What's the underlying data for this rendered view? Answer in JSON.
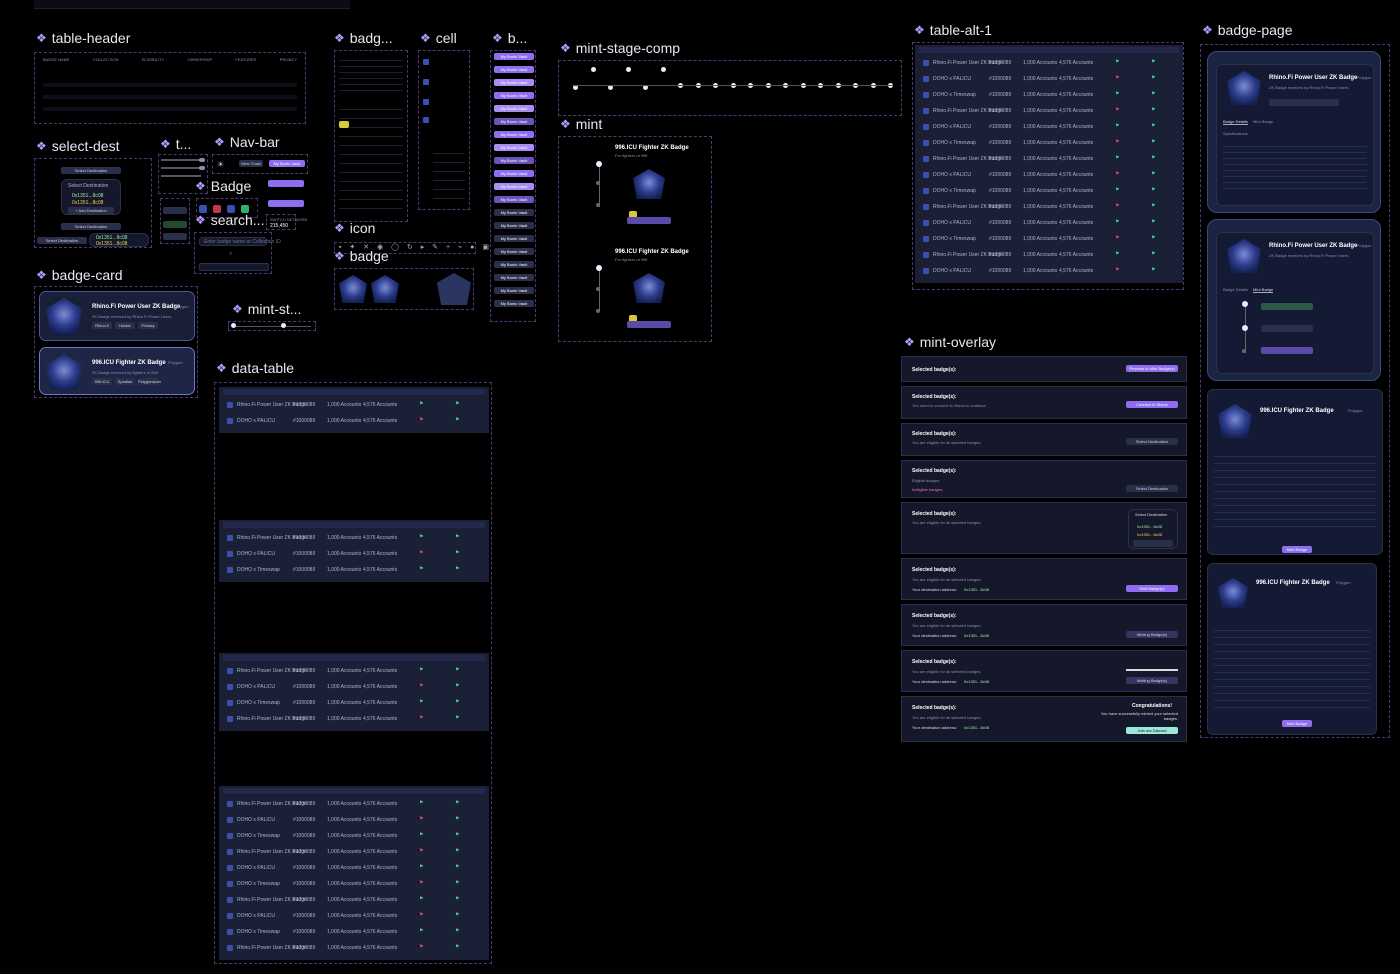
{
  "sections": {
    "table_header": "table-header",
    "select_dest": "select-dest",
    "t": "t...",
    "nav_bar": "Nav-bar",
    "badge_small": "Badge",
    "search": "search...",
    "badge_card": "badge-card",
    "badg": "badg...",
    "cell": "cell",
    "icon": "icon",
    "badge": "badge",
    "b": "b...",
    "mint_stage_comp": "mint-stage-comp",
    "mint": "mint",
    "mint_st": "mint-st...",
    "data_table": "data-table",
    "table_alt_1": "table-alt-1",
    "mint_overlay": "mint-overlay",
    "badge_page": "badge-page"
  },
  "select_dest": {
    "label": "Select Destination",
    "option1": "0x1351...8c08",
    "option2": "0x1351...8c08",
    "add": "+ Add Destination"
  },
  "nav_bar": {
    "view_chain": "View Chain",
    "my_bonto": "My Bonto Vault"
  },
  "search": {
    "placeholder": "Enter badge name or Collection ID",
    "switch_network": "SWITCH NETWORK",
    "value": "215,450"
  },
  "badge_card": [
    {
      "title": "Rhino.Fi Power User ZK Badge",
      "network": "Polygon",
      "desc": "ZK Badge received by Rhino.Fi Power Users",
      "tags": [
        "Rhino.fi",
        "Holder",
        "Privacy"
      ]
    },
    {
      "title": "996.ICU Fighter ZK Badge",
      "network": "Polygon",
      "desc": "ZK Badge received by fighters of 996",
      "tags": [
        "996.ICU",
        "Spadian",
        "Polygonscan"
      ]
    }
  ],
  "mint": {
    "card1_title": "996.ICU Fighter ZK Badge",
    "card2_title": "996.ICU Fighter ZK Badge",
    "card1_sub": "For fighters of 996",
    "card2_sub": "For fighters of 996"
  },
  "table_rows": {
    "name": "Rhino.Fi Power User ZK Badge",
    "name2": "DOHO x PALICU",
    "name3": "DOHO x Timeswap",
    "id": "#1000089",
    "accounts": "1,000 Accounts",
    "accounts2": "4,576 Accounts"
  },
  "overlay": {
    "selected": "Selected badge(s):",
    "proceed": "Proceed to Mint Badge(s)",
    "connect_note": "You need to connect to Sismo to continue.",
    "connect": "Connect to Sismo",
    "eligible": "You are eligible for all selected badges.",
    "eligible_badges": "Eligible badges:",
    "ineligible": "Ineligible badges:",
    "select_destination": "Select Destination",
    "address": "0x1351...8c08",
    "your_destination": "Your destination address:",
    "mint_badges": "Mint Badge(s)",
    "minting": "Minting Badge(s)",
    "congrats": "Congratulations!",
    "congrats_sub": "You have successfully minted your selected badges.",
    "join_discord": "Join our Discord"
  },
  "badge_page": {
    "title1": "Rhino.Fi Power User ZK Badge",
    "title2": "Rhino.Fi Power User ZK Badge",
    "title3": "996.ICU Fighter ZK Badge",
    "title4": "996.ICU Fighter ZK Badge",
    "network": "Polygon",
    "desc": "ZK Badge received by Rhino.Fi Power Users",
    "tab_details": "Badge Details",
    "tab_mint": "Mint Badge",
    "mint_button": "Mint Badge",
    "specs": "Specifications"
  }
}
